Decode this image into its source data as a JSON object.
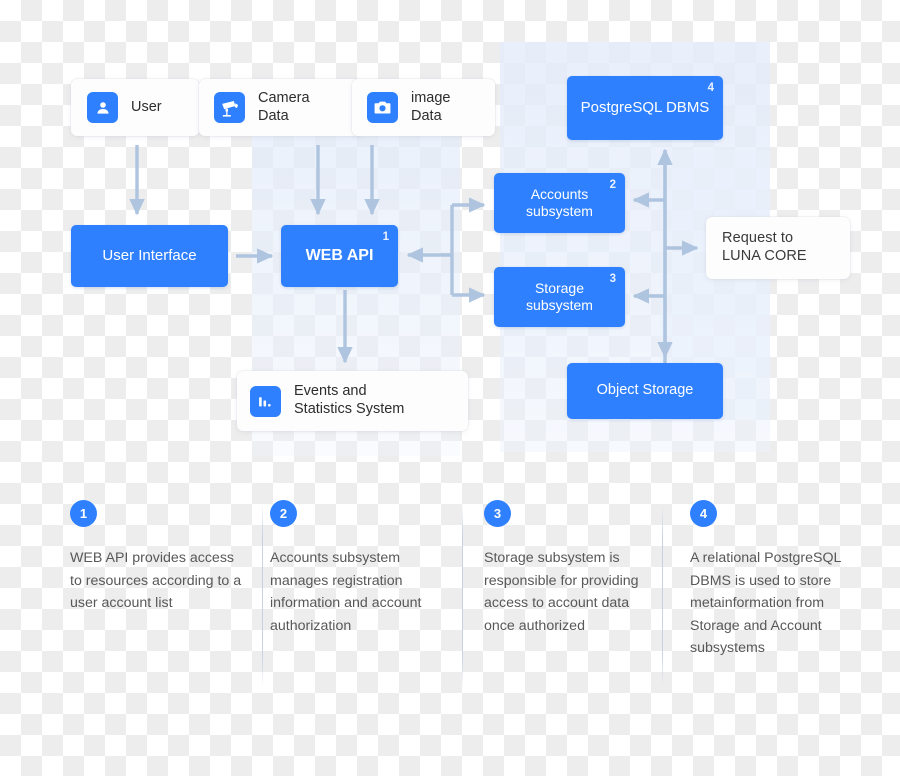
{
  "theme": {
    "accent_blue": "#2F80FF",
    "arrow_blue": "#AEC4DF",
    "panel_blue": "#E5EDFA",
    "text_dark": "#2D2D2D",
    "text_muted": "#585858"
  },
  "diagram": {
    "inputs": [
      {
        "id": "user",
        "icon": "person-icon",
        "label": "User"
      },
      {
        "id": "camera",
        "icon": "cctv-camera-icon",
        "label": "Camera\nData"
      },
      {
        "id": "image",
        "icon": "photo-camera-icon",
        "label": "image\nData"
      }
    ],
    "nodes": {
      "user_interface": {
        "label": "User Interface",
        "badge": ""
      },
      "web_api": {
        "label": "WEB API",
        "badge": "1"
      },
      "accounts": {
        "label": "Accounts\nsubsystem",
        "badge": "2"
      },
      "storage": {
        "label": "Storage\nsubsystem",
        "badge": "3"
      },
      "postgresql": {
        "label": "PostgreSQL\nDBMS",
        "badge": "4"
      },
      "object_storage": {
        "label": "Object Storage",
        "badge": ""
      }
    },
    "cards": {
      "events": {
        "icon": "bar-chart-icon",
        "label": "Events and\nStatistics System"
      },
      "luna": {
        "label": "Request to\nLUNA CORE"
      }
    }
  },
  "legend": {
    "notes": [
      {
        "num": "1",
        "text": "WEB API provides access to resources according to a user account list"
      },
      {
        "num": "2",
        "text": "Accounts subsystem manages registration information and account authorization"
      },
      {
        "num": "3",
        "text": "Storage subsystem is responsible for providing access to account data once authorized"
      },
      {
        "num": "4",
        "text": "A relational PostgreSQL DBMS is used to store metainformation from Storage and Account subsystems"
      }
    ]
  }
}
